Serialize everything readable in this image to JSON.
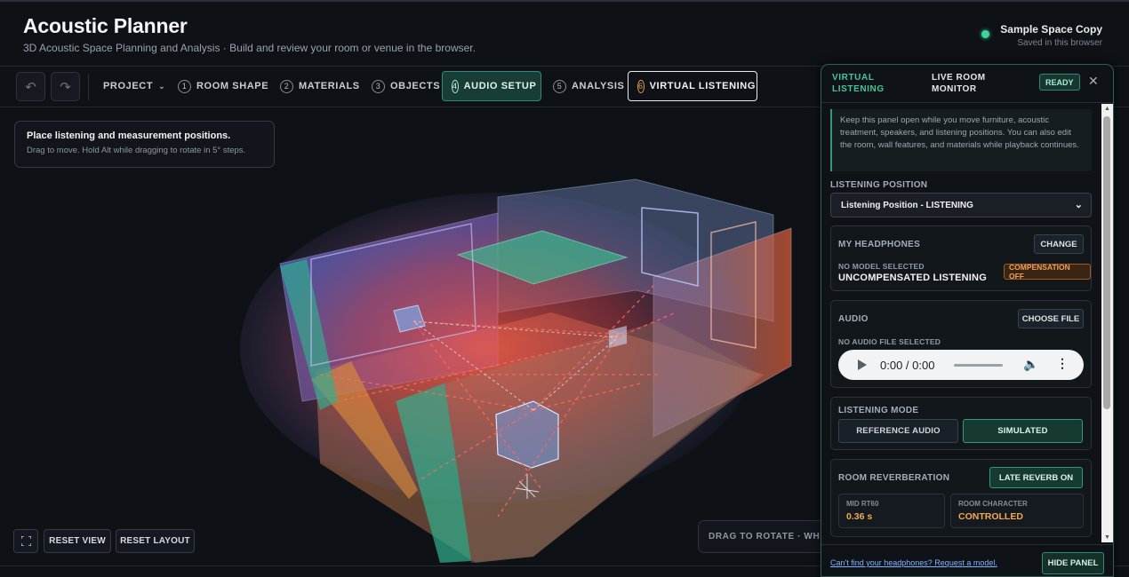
{
  "header": {
    "title": "Acoustic Planner",
    "subtitle": "3D Acoustic Space Planning and Analysis · Build and review your room or venue in the browser.",
    "space_name": "Sample Space Copy",
    "save_status": "Saved in this browser"
  },
  "toolbar": {
    "undo_icon": "undo-icon",
    "redo_icon": "redo-icon",
    "project_label": "PROJECT",
    "steps": [
      {
        "num": "1",
        "label": "ROOM SHAPE"
      },
      {
        "num": "2",
        "label": "MATERIALS"
      },
      {
        "num": "3",
        "label": "OBJECTS"
      },
      {
        "num": "4",
        "label": "AUDIO SETUP"
      },
      {
        "num": "5",
        "label": "ANALYSIS"
      },
      {
        "num": "6",
        "label": "VIRTUAL LISTENING"
      }
    ]
  },
  "viewport": {
    "hint_title": "Place listening and measurement positions.",
    "hint_sub": "Drag to move. Hold Alt while dragging to rotate in 5° steps.",
    "reset_view": "RESET VIEW",
    "reset_layout": "RESET LAYOUT",
    "rotate_hint": "DRAG TO ROTATE · WHEE",
    "fullscreen_icon": "fullscreen-icon"
  },
  "panel": {
    "tab_virtual": "VIRTUAL LISTENING",
    "tab_monitor": "LIVE ROOM MONITOR",
    "status": "READY",
    "notice": "Keep this panel open while you move furniture, acoustic treatment, speakers, and listening positions. You can also edit the room, wall features, and materials while playback continues.",
    "listening_position_label": "LISTENING POSITION",
    "listening_position_value": "Listening Position - LISTENING",
    "headphones": {
      "title": "MY HEADPHONES",
      "change": "CHANGE",
      "model_label": "NO MODEL SELECTED",
      "model_value": "UNCOMPENSATED LISTENING",
      "badge": "COMPENSATION OFF"
    },
    "audio": {
      "title": "AUDIO",
      "choose": "CHOOSE FILE",
      "file_status": "NO AUDIO FILE SELECTED",
      "time": "0:00 / 0:00"
    },
    "mode": {
      "title": "LISTENING MODE",
      "reference": "REFERENCE AUDIO",
      "simulated": "SIMULATED"
    },
    "reverb": {
      "title": "ROOM REVERBERATION",
      "toggle": "LATE REVERB ON",
      "rt60_label": "MID RT60",
      "rt60_value": "0.36 s",
      "character_label": "ROOM CHARACTER",
      "character_value": "CONTROLLED"
    },
    "footer_link": "Can't find your headphones? Request a model.",
    "hide": "HIDE PANEL"
  }
}
